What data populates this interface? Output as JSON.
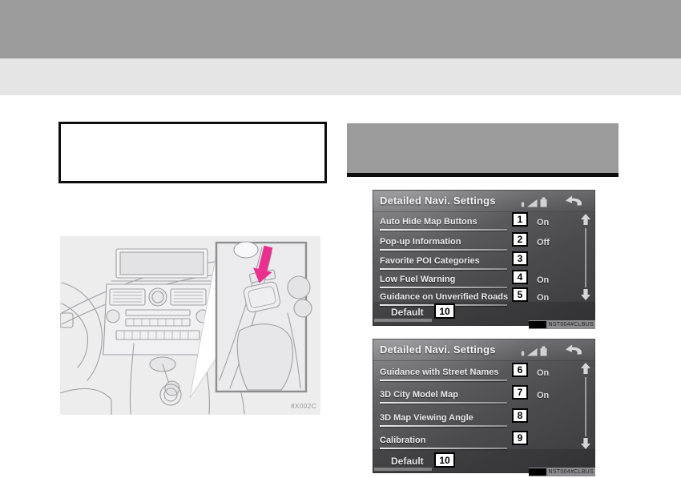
{
  "screen1": {
    "title": "Detailed Navi. Settings",
    "rows": [
      {
        "num": "1",
        "label": "Auto Hide Map Buttons",
        "value": "On"
      },
      {
        "num": "2",
        "label": "Pop-up Information",
        "value": "Off"
      },
      {
        "num": "3",
        "label": "Favorite POI Categories",
        "value": ""
      },
      {
        "num": "4",
        "label": "Low Fuel Warning",
        "value": "On"
      },
      {
        "num": "5",
        "label": "Guidance on Unverified Roads",
        "value": "On"
      }
    ],
    "default_label": "Default",
    "default_num": "10",
    "watermark": "NST004#CLBUS"
  },
  "screen2": {
    "title": "Detailed Navi. Settings",
    "rows": [
      {
        "num": "6",
        "label": "Guidance with Street Names",
        "value": "On"
      },
      {
        "num": "7",
        "label": "3D City Model Map",
        "value": "On"
      },
      {
        "num": "8",
        "label": "3D Map Viewing Angle",
        "value": ""
      },
      {
        "num": "9",
        "label": "Calibration",
        "value": ""
      }
    ],
    "default_label": "Default",
    "default_num": "10",
    "watermark": "NST004#CLBUS"
  },
  "illustration": {
    "code": "8X002C",
    "arrow_icon": "pink-down-arrow-indicator"
  },
  "icons": {
    "status": [
      "phone-icon",
      "signal-strength-icon",
      "battery-icon"
    ],
    "back": "return-arrow-icon",
    "scroll_up": "scroll-up-icon",
    "scroll_down": "scroll-down-icon"
  },
  "colors": {
    "accent_pink": "#e9308f",
    "top_bar": "#9a9b9a",
    "sub_bar": "#e5e5e6",
    "screen_text": "#eaeaea",
    "section_rule": "#0d0d0d"
  }
}
